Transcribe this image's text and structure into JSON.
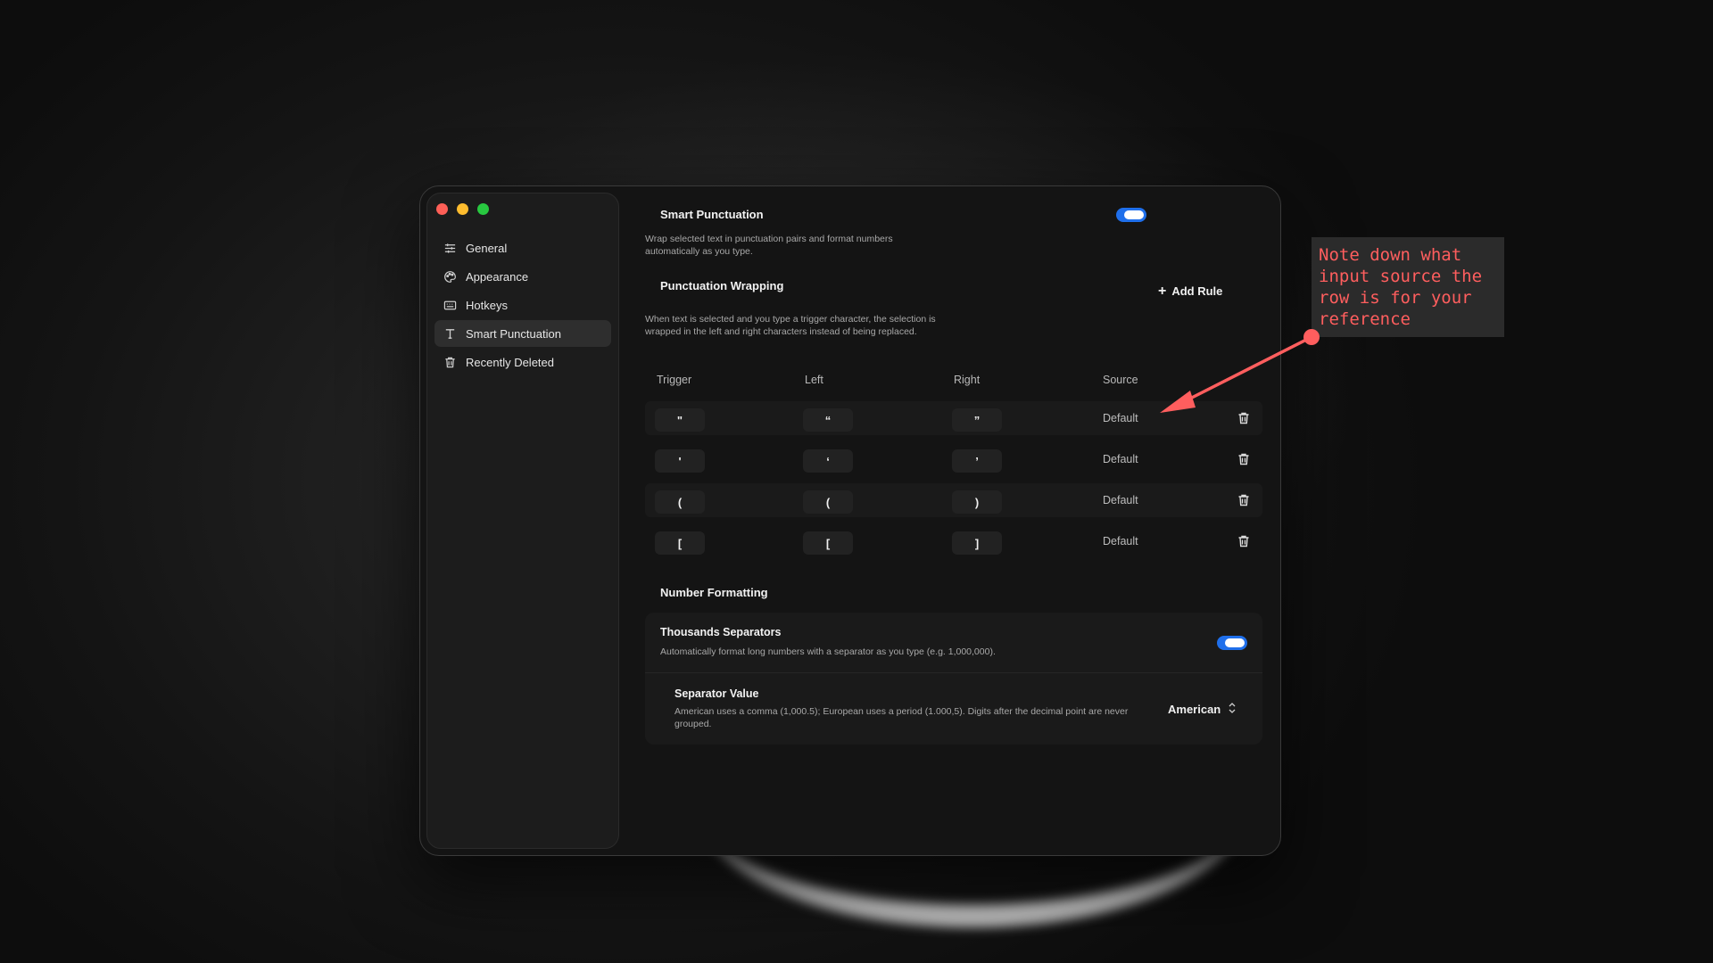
{
  "window": {
    "sidebar": {
      "items": [
        {
          "label": "General",
          "icon": "sliders-icon",
          "active": false
        },
        {
          "label": "Appearance",
          "icon": "palette-icon",
          "active": false
        },
        {
          "label": "Hotkeys",
          "icon": "keyboard-icon",
          "active": false
        },
        {
          "label": "Smart Punctuation",
          "icon": "text-t-icon",
          "active": true
        },
        {
          "label": "Recently Deleted",
          "icon": "trash-icon",
          "active": false
        }
      ]
    },
    "smart_punctuation": {
      "title": "Smart Punctuation",
      "description": "Wrap selected text in punctuation pairs and format numbers automatically as you type.",
      "enabled": true
    },
    "punctuation_wrapping": {
      "title": "Punctuation Wrapping",
      "add_rule_label": "Add Rule",
      "description": "When text is selected and you type a trigger character, the selection is wrapped in the left and right characters instead of being replaced.",
      "columns": [
        "Trigger",
        "Left",
        "Right",
        "Source"
      ],
      "rows": [
        {
          "trigger": "\"",
          "left": "“",
          "right": "”",
          "source": "Default"
        },
        {
          "trigger": "'",
          "left": "‘",
          "right": "’",
          "source": "Default"
        },
        {
          "trigger": "(",
          "left": "(",
          "right": ")",
          "source": "Default"
        },
        {
          "trigger": "[",
          "left": "[",
          "right": "]",
          "source": "Default"
        }
      ]
    },
    "number_formatting": {
      "title": "Number Formatting",
      "thousands": {
        "title": "Thousands Separators",
        "description": "Automatically format long numbers with a separator as you type (e.g. 1,000,000).",
        "enabled": true
      },
      "separator": {
        "title": "Separator Value",
        "description": "American uses a comma (1,000.5); European uses a period (1.000,5). Digits after the decimal point are never grouped.",
        "value": "American"
      }
    }
  },
  "annotation": {
    "note": "Note down what\ninput source the\nrow is for your\nreference",
    "color": "#ff5e5e"
  },
  "colors": {
    "accent": "#1f6feb",
    "traffic_red": "#fe5f57",
    "traffic_yellow": "#febc2e",
    "traffic_green": "#28c840"
  }
}
